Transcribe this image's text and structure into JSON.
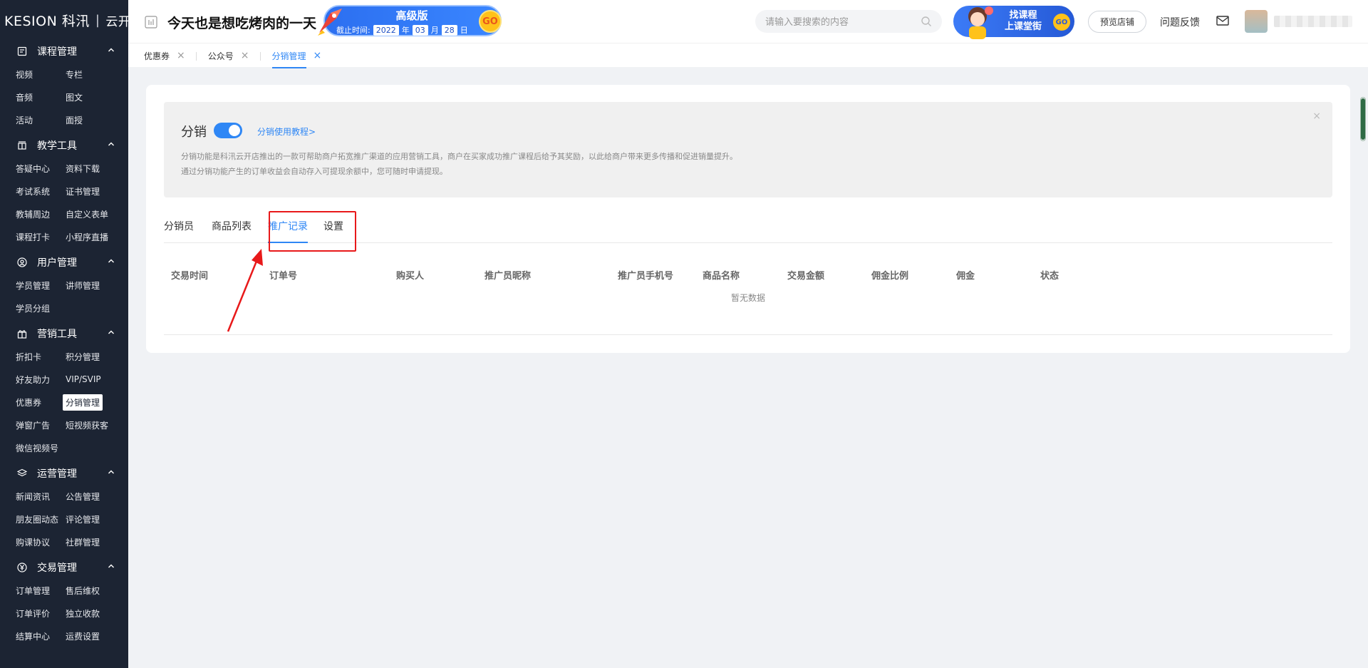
{
  "sidebar": {
    "brand_logo": "KESION 科汛",
    "brand_sep": "|",
    "brand_shop": "云开店",
    "groups": [
      {
        "title": "课程管理",
        "icon": "course-icon",
        "items": [
          "视频",
          "专栏",
          "音频",
          "图文",
          "活动",
          "面授"
        ]
      },
      {
        "title": "教学工具",
        "icon": "teaching-icon",
        "items": [
          "答疑中心",
          "资料下载",
          "考试系统",
          "证书管理",
          "教辅周边",
          "自定义表单",
          "课程打卡",
          "小程序直播"
        ]
      },
      {
        "title": "用户管理",
        "icon": "user-icon",
        "items": [
          "学员管理",
          "讲师管理",
          "学员分组"
        ]
      },
      {
        "title": "营销工具",
        "icon": "gift-icon",
        "items": [
          "折扣卡",
          "积分管理",
          "好友助力",
          "VIP/SVIP",
          "优惠券",
          "分销管理",
          "弹窗广告",
          "短视频获客",
          "微信视频号"
        ]
      },
      {
        "title": "运营管理",
        "icon": "layers-icon",
        "items": [
          "新闻资讯",
          "公告管理",
          "朋友圈动态",
          "评论管理",
          "购课协议",
          "社群管理"
        ]
      },
      {
        "title": "交易管理",
        "icon": "yen-icon",
        "items": [
          "订单管理",
          "售后维权",
          "订单评价",
          "独立收款",
          "结算中心",
          "运费设置"
        ]
      }
    ],
    "active_item": "分销管理"
  },
  "header": {
    "store_title": "今天也是想吃烤肉的一天",
    "promo": {
      "version": "高级版",
      "deadline_label": "截止时间:",
      "year": "2022",
      "year_unit": "年",
      "month": "03",
      "month_unit": "月",
      "day": "28",
      "day_unit": "日",
      "go": "GO"
    },
    "search_placeholder": "请输入要搜索的内容",
    "course_ad_line1": "找课程",
    "course_ad_line2": "上课堂街",
    "course_ad_go": "GO",
    "preview_button": "预览店铺",
    "feedback": "问题反馈"
  },
  "tabs": [
    {
      "label": "优惠券",
      "active": false
    },
    {
      "label": "公众号",
      "active": false
    },
    {
      "label": "分销管理",
      "active": true
    }
  ],
  "main": {
    "notice_title": "分销",
    "toggle_on": true,
    "tutorial_link": "分销使用教程>",
    "desc_line1": "分销功能是科汛云开店推出的一款可帮助商户拓宽推广渠道的应用营销工具，商户在买家成功推广课程后给予其奖励，以此给商户带来更多传播和促进销量提升。",
    "desc_line2": "通过分销功能产生的订单收益会自动存入可提现余额中，您可随时申请提现。",
    "close": "×",
    "subtabs": [
      "分销员",
      "商品列表",
      "推广记录",
      "设置"
    ],
    "active_subtab": "推广记录",
    "columns": [
      "交易时间",
      "订单号",
      "购买人",
      "推广员昵称",
      "推广员手机号",
      "商品名称",
      "交易金额",
      "佣金比例",
      "佣金",
      "状态"
    ],
    "empty_text": "暂无数据"
  },
  "colors": {
    "sidebar_bg": "#1c2433",
    "accent": "#2f87f5",
    "highlight": "#e8191a"
  }
}
